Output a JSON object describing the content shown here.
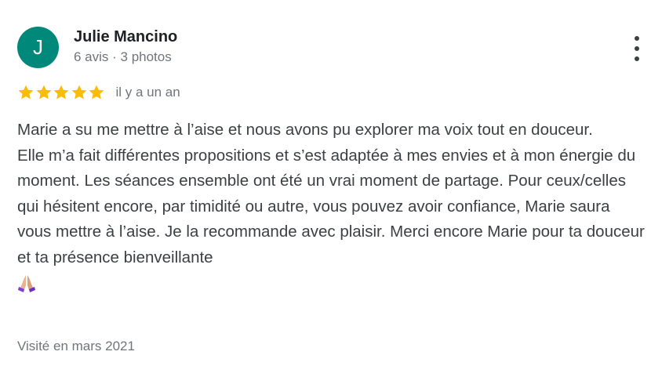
{
  "reviewer": {
    "initial": "J",
    "name": "Julie Mancino",
    "meta": "6 avis · 3 photos",
    "avatar_color": "#00897b"
  },
  "rating": {
    "stars": 5,
    "max": 5,
    "star_color": "#fbbc04",
    "time_ago": "il y a un an"
  },
  "review": {
    "paragraphs": [
      "Marie a su me mettre à l’aise et nous avons pu explorer ma voix tout en douceur.",
      "Elle m’a fait différentes propositions et s’est adaptée à mes envies et à mon énergie du moment. Les séances ensemble ont été un vrai moment de partage. Pour ceux/celles qui hésitent encore, par timidité ou autre, vous pouvez avoir confiance, Marie saura vous mettre à l’aise. Je la recommande avec plaisir. Merci encore Marie pour ta douceur et ta présence bienveillante"
    ],
    "trailing_emoji": "folded-hands-icon"
  },
  "visited": "Visité en mars 2021",
  "menu": {
    "icon": "more-vert-icon"
  }
}
